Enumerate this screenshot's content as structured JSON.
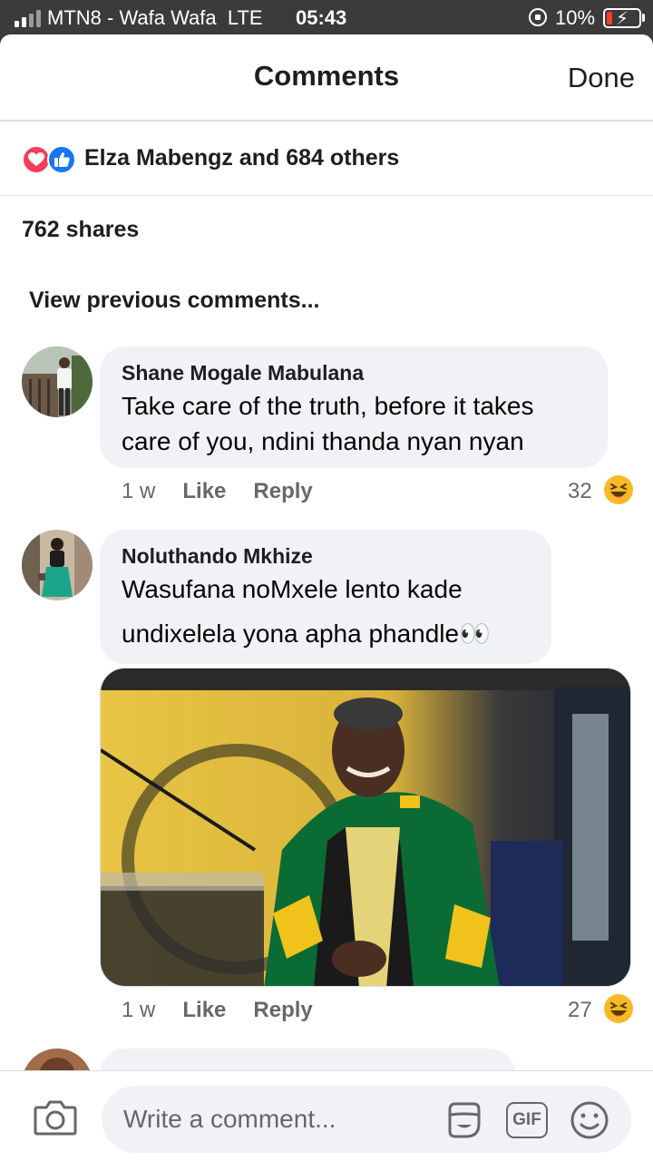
{
  "status_bar": {
    "carrier": "MTN8 - Wafa Wafa",
    "network": "LTE",
    "time": "05:43",
    "battery_percent": "10%",
    "battery_color": "#ff3b30"
  },
  "header": {
    "title": "Comments",
    "done_label": "Done"
  },
  "reactions": {
    "summary": "Elza Mabengz and 684 others",
    "icons": [
      "heart-icon",
      "like-icon"
    ]
  },
  "shares": "762 shares",
  "view_previous": "View previous comments...",
  "comments": [
    {
      "author": "Shane Mogale Mabulana",
      "text_lines": [
        "Take care of the truth, before it takes",
        "care of you, ndini thanda nyan nyan"
      ],
      "time": "1 w",
      "like_label": "Like",
      "reply_label": "Reply",
      "reaction_count": "32",
      "reaction_icon": "laughing-emoji-icon"
    },
    {
      "author": "Noluthando Mkhize",
      "text_lines": [
        "Wasufana noMxele lento kade",
        "undixelela yona apha phandle👀"
      ],
      "time": "1 w",
      "like_label": "Like",
      "reply_label": "Reply",
      "reaction_count": "27",
      "reaction_icon": "laughing-emoji-icon",
      "has_photo": true
    }
  ],
  "composer": {
    "placeholder": "Write a comment...",
    "gif_label": "GIF"
  },
  "colors": {
    "accent_blue": "#1877f2",
    "heart_red": "#f33e58",
    "bubble_bg": "#f0f2f5",
    "muted_text": "#65676b"
  }
}
